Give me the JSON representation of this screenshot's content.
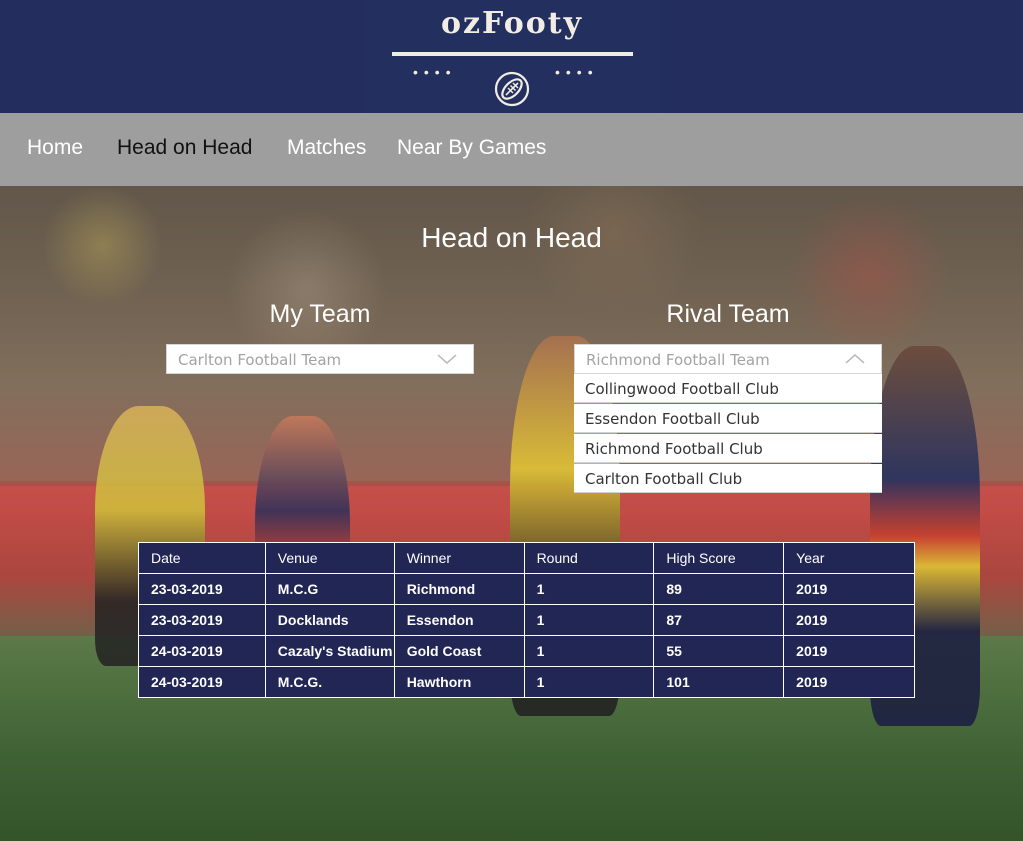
{
  "brand": {
    "title": "ozFooty",
    "dots": "••••"
  },
  "nav": {
    "items": [
      {
        "label": "Home"
      },
      {
        "label": "Head on Head"
      },
      {
        "label": "Matches"
      },
      {
        "label": "Near By Games"
      }
    ],
    "active_index": 1
  },
  "main": {
    "title": "Head on Head",
    "my_team": {
      "label": "My Team",
      "selected": "Carlton Football Team"
    },
    "rival_team": {
      "label": "Rival Team",
      "selected": "Richmond Football Team",
      "options": [
        "Collingwood Football Club",
        "Essendon Football Club",
        "Richmond Football Club",
        "Carlton Football Club"
      ]
    }
  },
  "table": {
    "headers": [
      "Date",
      "Venue",
      "Winner",
      "Round",
      "High Score",
      "Year"
    ],
    "rows": [
      [
        "23-03-2019",
        "M.C.G",
        "Richmond",
        "1",
        "89",
        "2019"
      ],
      [
        "23-03-2019",
        "Docklands",
        "Essendon",
        "1",
        "87",
        "2019"
      ],
      [
        "24-03-2019",
        "Cazaly's Stadium",
        "Gold Coast",
        "1",
        "55",
        "2019"
      ],
      [
        "24-03-2019",
        "M.C.G.",
        "Hawthorn",
        "1",
        "101",
        "2019"
      ]
    ]
  },
  "colors": {
    "header_bg": "#232d5e",
    "nav_bg": "#9e9e9e",
    "table_bg": "#222655"
  },
  "icons": [
    "football-icon",
    "chevron-down-icon",
    "chevron-up-icon"
  ]
}
